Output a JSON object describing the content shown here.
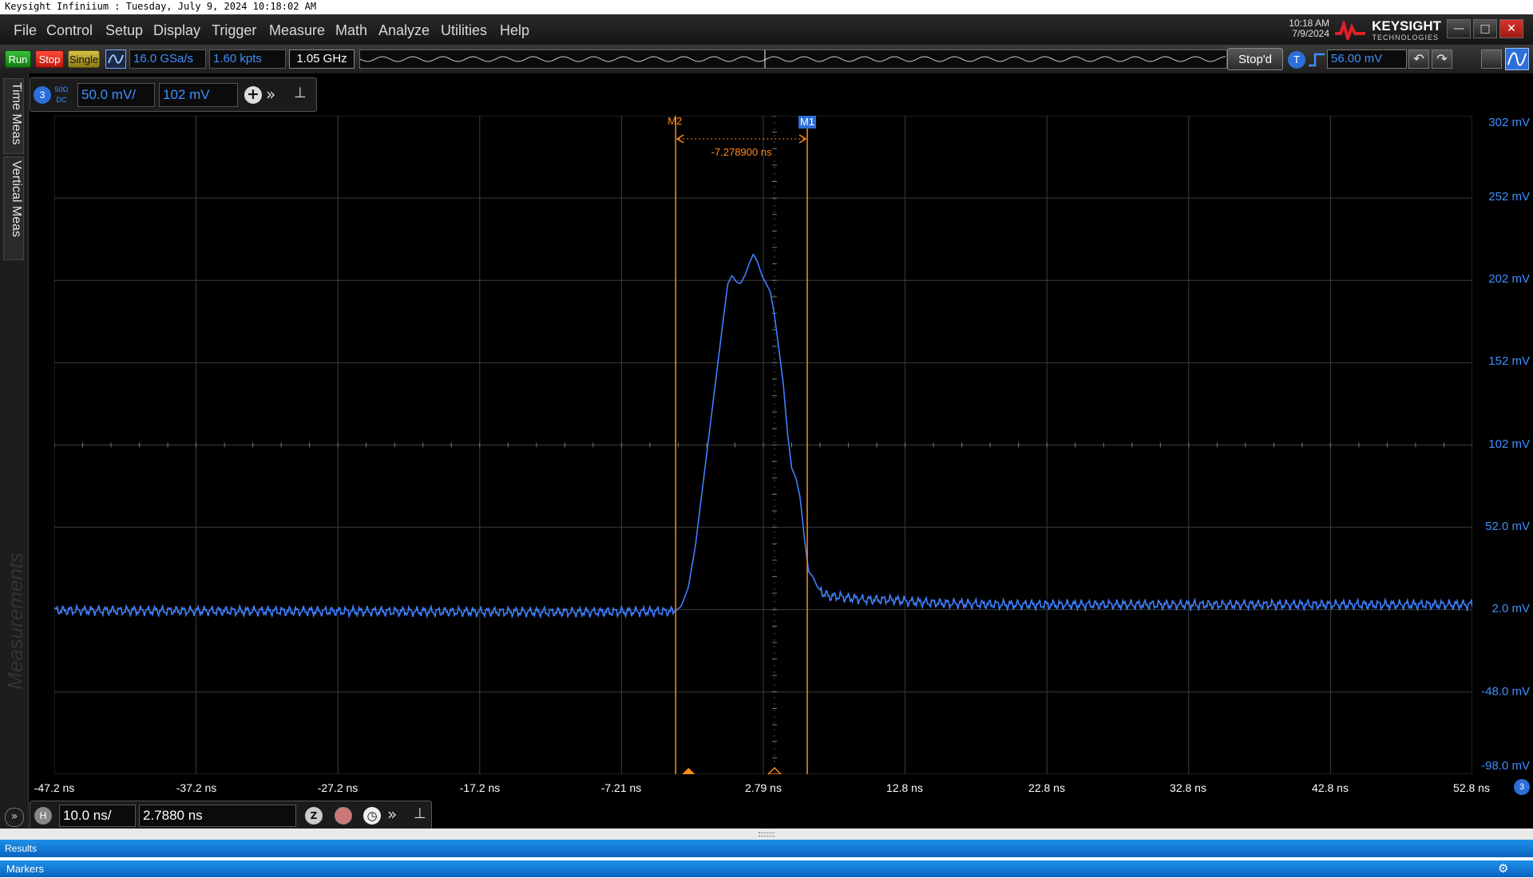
{
  "window": {
    "title": "Keysight Infiniium : Tuesday, July 9, 2024 10:18:02 AM"
  },
  "menu": [
    "File",
    "Control",
    "Setup",
    "Display",
    "Trigger",
    "Measure",
    "Math",
    "Analyze",
    "Utilities",
    "Help"
  ],
  "status": {
    "time": "10:18 AM",
    "date": "7/9/2024",
    "brand": "KEYSIGHT",
    "brand_sub": "TECHNOLOGIES"
  },
  "toolbar": {
    "run": "Run",
    "stop": "Stop",
    "single": "Single",
    "sample_rate": "16.0 GSa/s",
    "memory_depth": "1.60 kpts",
    "bandwidth": "1.05 GHz",
    "acq_state": "Stop'd",
    "trigger_badge": "T",
    "trigger_level": "56.00 mV"
  },
  "side_tabs": {
    "time_meas": "Time Meas",
    "vertical_meas": "Vertical Meas",
    "measurements": "Measurements"
  },
  "channel": {
    "number": "3",
    "impedance": "50Ω",
    "coupling": "DC",
    "scale": "50.0 mV/",
    "offset": "102 mV"
  },
  "horizontal": {
    "badge": "H",
    "scale": "10.0 ns/",
    "position": "2.7880 ns"
  },
  "markers": {
    "m1_label": "M1",
    "m2_label": "M2",
    "delta": "-7.278900 ns",
    "trigger_marker": "T"
  },
  "chart_data": {
    "type": "line",
    "xlabel": "",
    "ylabel": "",
    "x_ticks": [
      "-47.2 ns",
      "-37.2 ns",
      "-27.2 ns",
      "-17.2 ns",
      "-7.21 ns",
      "2.79 ns",
      "12.8 ns",
      "22.8 ns",
      "32.8 ns",
      "42.8 ns",
      "52.8 ns"
    ],
    "y_ticks": [
      "302 mV",
      "252 mV",
      "202 mV",
      "152 mV",
      "102 mV",
      "52.0 mV",
      "2.0 mV",
      "-48.0 mV",
      "-98.0 mV"
    ],
    "xlim": [
      -47.2,
      52.8
    ],
    "ylim": [
      -98,
      302
    ],
    "grid": true,
    "series": [
      {
        "color": "#3f7fff",
        "x": [
          -47.2,
          -10,
          -3.4,
          -3.0,
          -2.5,
          -2.0,
          -1.5,
          -1.0,
          -0.5,
          0.0,
          0.3,
          0.6,
          0.9,
          1.2,
          1.5,
          1.8,
          2.1,
          2.4,
          2.7,
          3.0,
          3.3,
          3.6,
          3.9,
          4.2,
          4.5,
          4.8,
          5.1,
          5.4,
          5.7,
          6.0,
          6.3,
          6.6,
          7.0,
          7.5,
          8.0,
          9.0,
          10.0,
          11.0,
          12.0,
          13.0,
          15.0,
          20.0,
          52.8
        ],
        "y": [
          1.5,
          0.5,
          1,
          4,
          15,
          40,
          75,
          110,
          145,
          180,
          200,
          205,
          201,
          200,
          205,
          212,
          218,
          213,
          205,
          200,
          195,
          180,
          160,
          140,
          110,
          88,
          82,
          70,
          45,
          25,
          22,
          16,
          12,
          10,
          10,
          9,
          8,
          8,
          8,
          7,
          6,
          5,
          5
        ]
      }
    ]
  }
}
